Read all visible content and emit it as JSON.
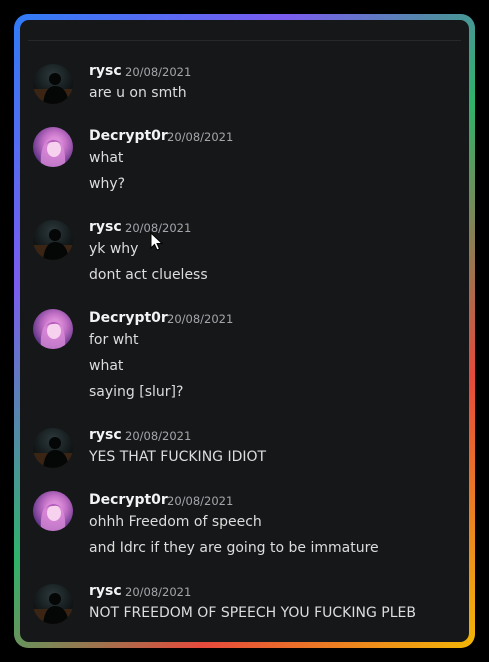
{
  "messages": [
    {
      "author": "rysc",
      "timestamp": "20/08/2021",
      "avatar": "rysc",
      "lines": [
        "are u on smth"
      ]
    },
    {
      "author": "Decrypt0r",
      "timestamp": "20/08/2021",
      "avatar": "decrypt",
      "lines": [
        "what",
        "why?"
      ]
    },
    {
      "author": "rysc",
      "timestamp": "20/08/2021",
      "avatar": "rysc",
      "lines": [
        "yk why",
        "dont act clueless"
      ]
    },
    {
      "author": "Decrypt0r",
      "timestamp": "20/08/2021",
      "avatar": "decrypt",
      "lines": [
        "for wht",
        "what",
        "saying [slur]?"
      ]
    },
    {
      "author": "rysc",
      "timestamp": "20/08/2021",
      "avatar": "rysc",
      "lines": [
        "YES THAT FUCKING IDIOT"
      ]
    },
    {
      "author": "Decrypt0r",
      "timestamp": "20/08/2021",
      "avatar": "decrypt",
      "lines": [
        "ohhh Freedom of speech",
        "and Idrc if they are going to be immature"
      ]
    },
    {
      "author": "rysc",
      "timestamp": "20/08/2021",
      "avatar": "rysc",
      "lines": [
        "NOT FREEDOM OF SPEECH YOU FUCKING PLEB"
      ]
    }
  ],
  "colors": {
    "panel": "#161718",
    "author": "#f2f3f5",
    "text": "#dcddde",
    "timestamp": "#a3a6aa"
  },
  "icons": [
    "mouse-cursor-icon"
  ]
}
